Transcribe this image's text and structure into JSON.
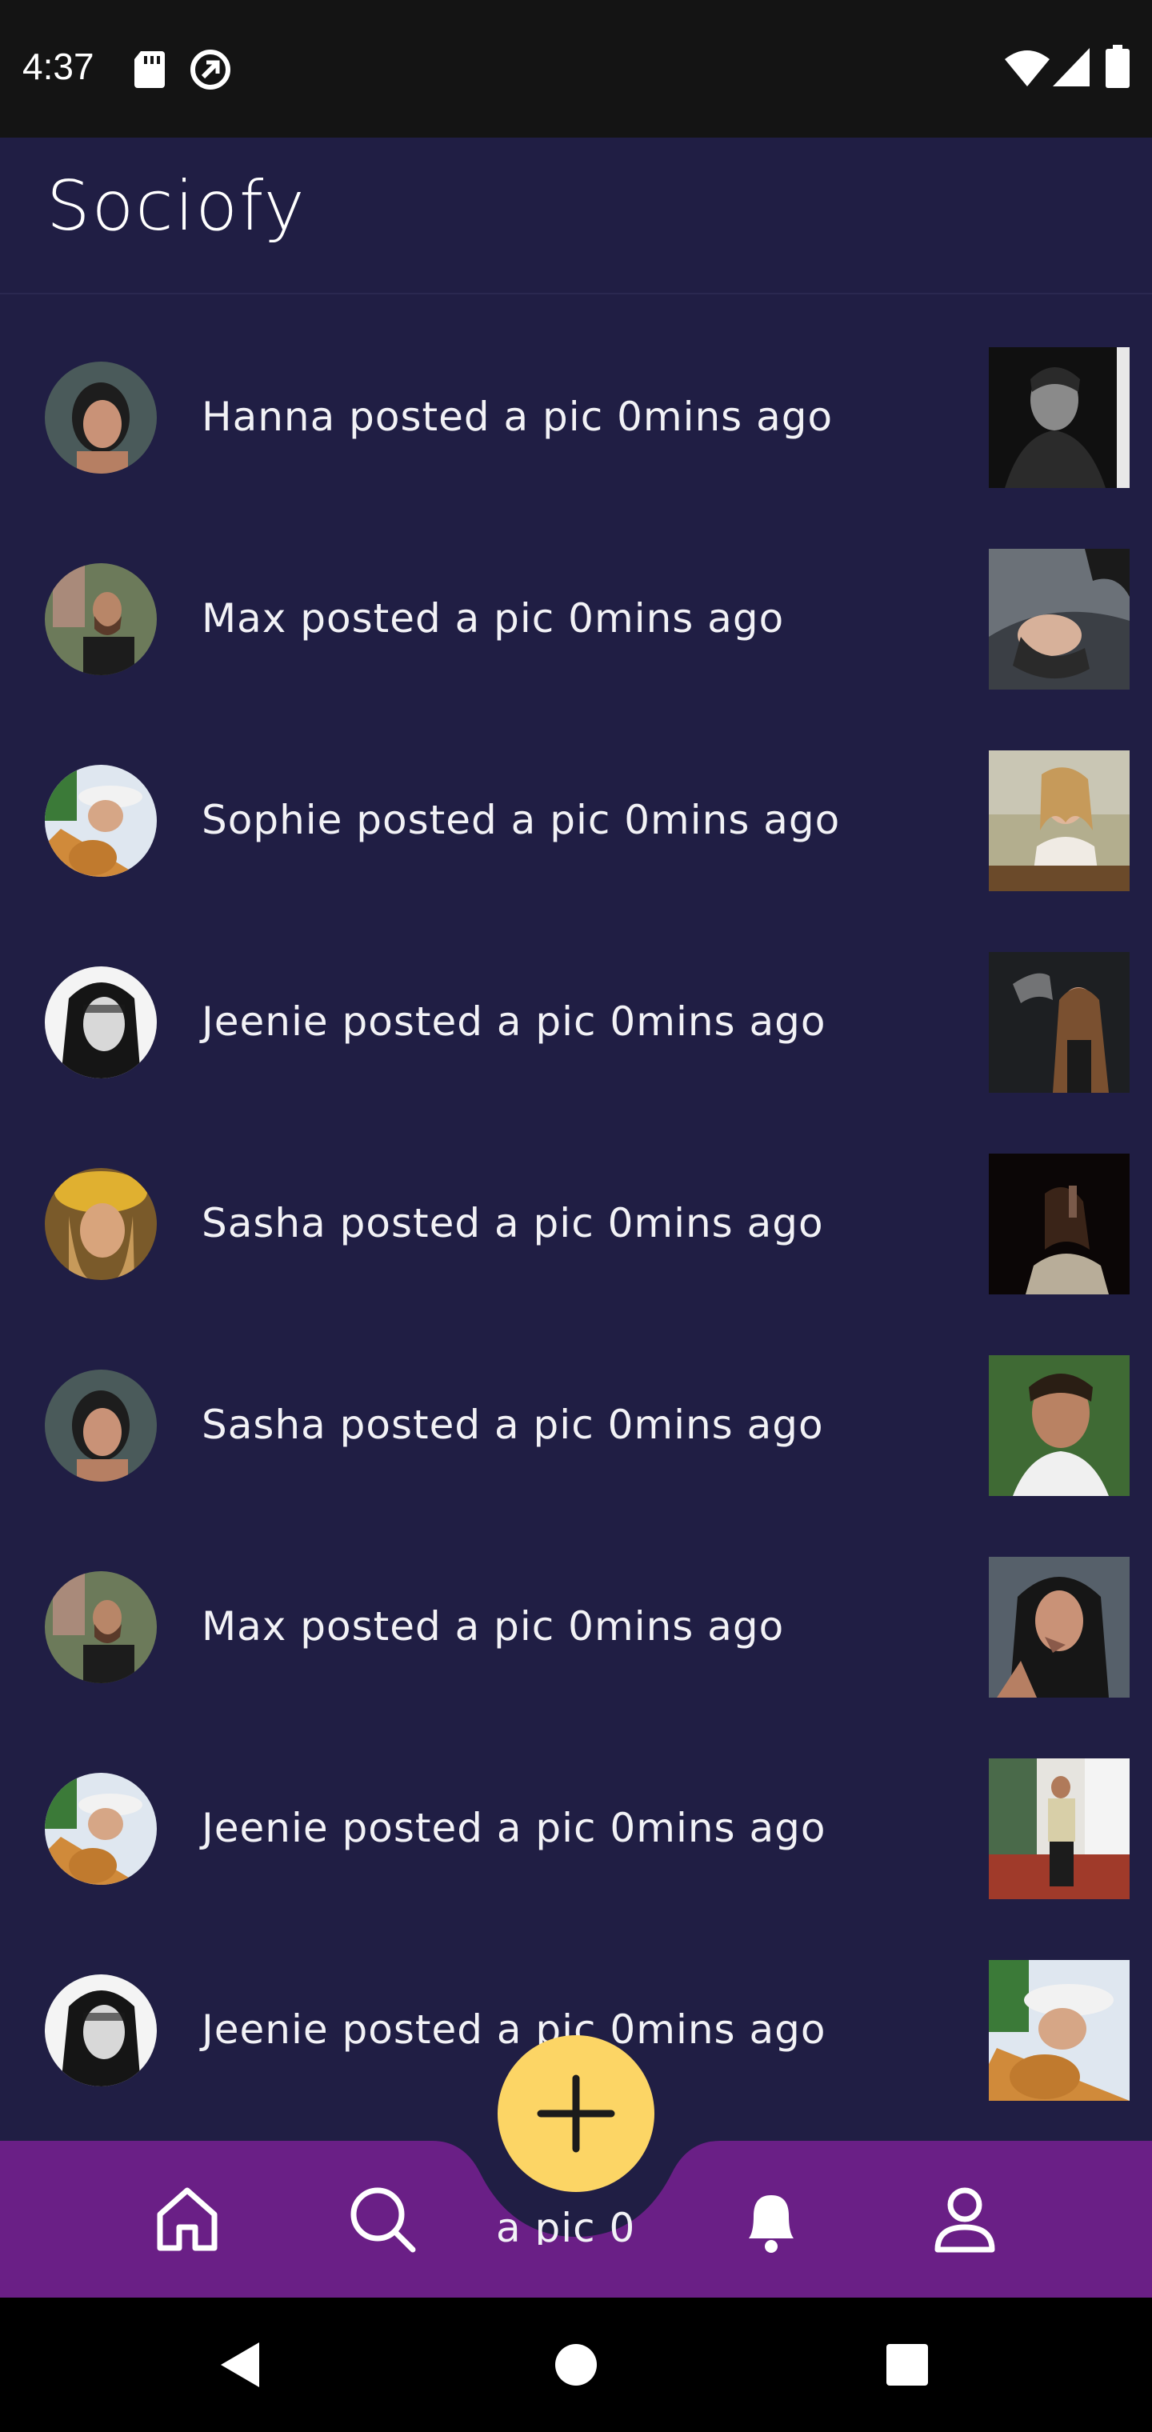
{
  "status_bar": {
    "time": "4:37",
    "icons": [
      "sd-card-icon",
      "sync-icon",
      "wifi-icon",
      "cellular-icon",
      "battery-icon"
    ]
  },
  "header": {
    "brand": "Sociofy"
  },
  "feed": {
    "items": [
      {
        "text": "Hanna posted a pic 0mins ago"
      },
      {
        "text": "Max posted a pic 0mins ago"
      },
      {
        "text": "Sophie posted a pic 0mins ago"
      },
      {
        "text": "Jeenie posted a pic 0mins ago"
      },
      {
        "text": "Sasha posted a pic 0mins ago"
      },
      {
        "text": "Sasha posted a pic 0mins ago"
      },
      {
        "text": "Max posted a pic 0mins ago"
      },
      {
        "text": "Jeenie posted a pic 0mins ago"
      },
      {
        "text": "Jeenie posted a pic 0mins ago"
      }
    ],
    "partial_text": "a pic 0"
  },
  "bottom_nav": {
    "items": [
      "home-icon",
      "search-icon",
      "add-icon",
      "bell-icon",
      "profile-icon"
    ],
    "accent_color": "#6a1f86",
    "fab_color": "#fcd565"
  },
  "colors": {
    "background": "#201e44",
    "status_bar": "#141414",
    "nav_bar": "#6a1f86"
  }
}
